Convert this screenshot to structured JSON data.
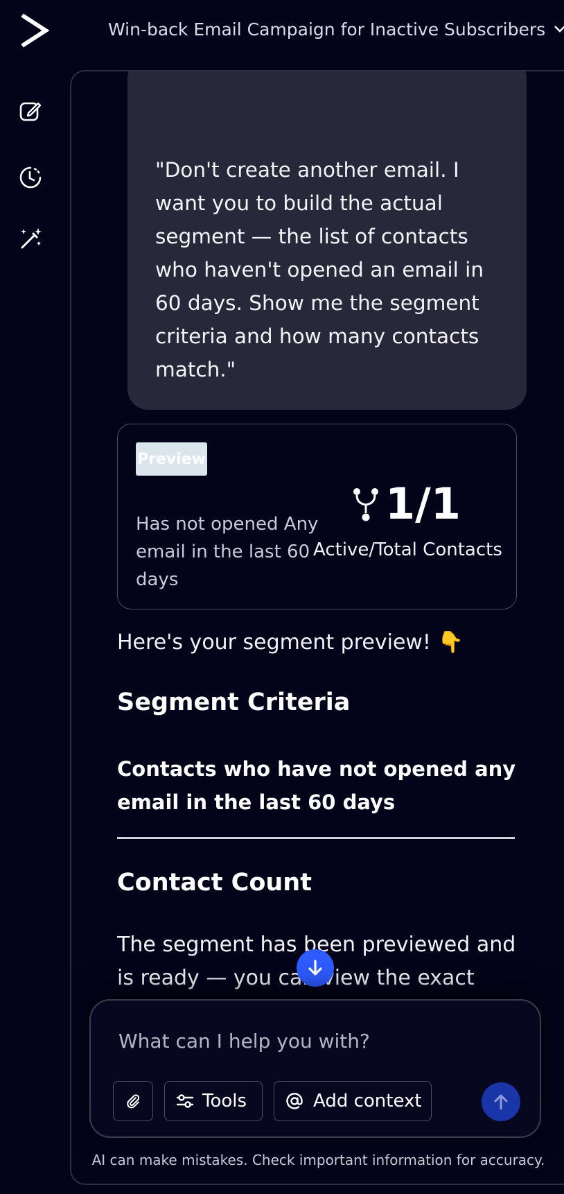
{
  "header": {
    "title": "Win-back Email Campaign for Inactive Subscribers"
  },
  "rail": {
    "icons": [
      "logo-icon",
      "new-chat-icon",
      "history-icon",
      "magic-wand-icon"
    ]
  },
  "conversation": {
    "user_message": "\"Don't create another email. I want you to build the actual segment — the list of contacts who haven't opened an email in 60 days. Show me the segment criteria and how many contacts match.\"",
    "preview_card": {
      "badge": "Preview",
      "criteria": "Has not opened Any email in the last 60 days",
      "stat_value": "1/1",
      "stat_label": "Active/Total Contacts"
    },
    "reply": {
      "intro": "Here's your segment preview! 👇",
      "segment_heading": "Segment Criteria",
      "segment_criteria": "Contacts who have not opened any email in the last 60 days",
      "count_heading": "Contact Count",
      "count_text": "The segment has been previewed and is ready — you can view the exact"
    }
  },
  "composer": {
    "placeholder": "What can I help you with?",
    "tools_label": "Tools",
    "context_label": "Add context"
  },
  "footer": {
    "disclaimer": "AI can make mistakes. Check important information for accuracy."
  },
  "colors": {
    "background": "#03031a",
    "bubble": "#272839",
    "accent": "#2e5bff",
    "send": "#1a35a8"
  }
}
